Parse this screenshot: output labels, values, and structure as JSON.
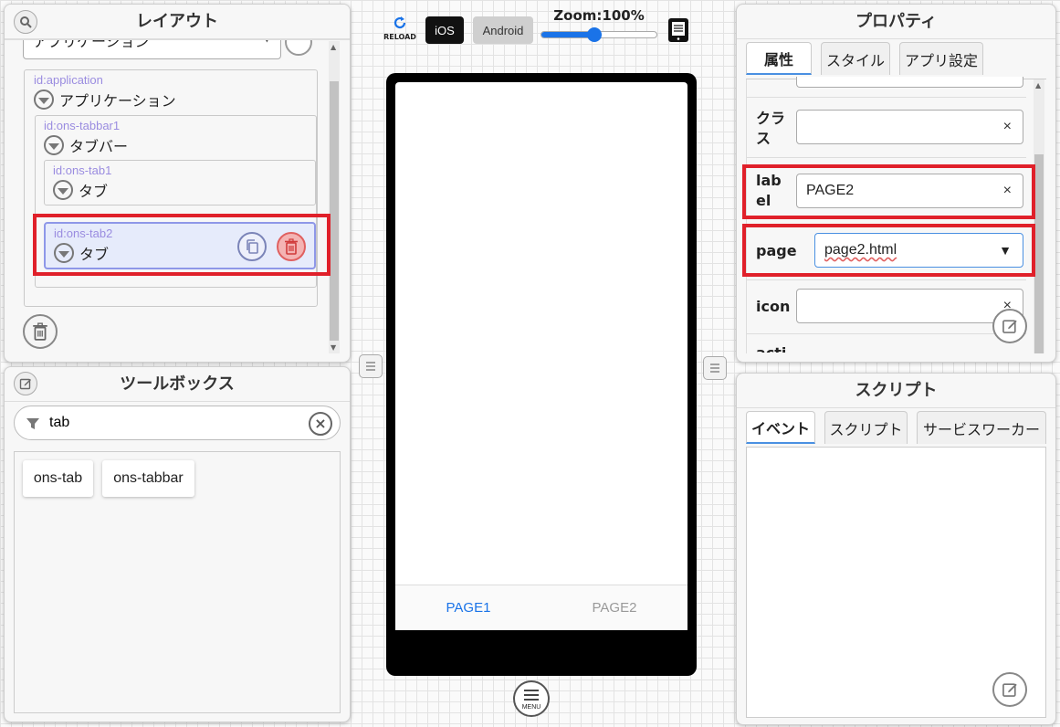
{
  "layout": {
    "title": "レイアウト",
    "top_select_value": "アプリケーション",
    "nodes": {
      "application": {
        "id": "id:application",
        "label": "アプリケーション"
      },
      "tabbar": {
        "id": "id:ons-tabbar1",
        "label": "タブバー"
      },
      "tab1": {
        "id": "id:ons-tab1",
        "label": "タブ"
      },
      "tab2": {
        "id": "id:ons-tab2",
        "label": "タブ"
      }
    }
  },
  "toolbox": {
    "title": "ツールボックス",
    "filter_value": "tab",
    "items": [
      "ons-tab",
      "ons-tabbar"
    ]
  },
  "toolbar": {
    "reload_label": "RELOAD",
    "ios_label": "iOS",
    "android_label": "Android",
    "zoom_label": "Zoom:100%",
    "zoom_value": 0.45
  },
  "phone": {
    "tabs": [
      "PAGE1",
      "PAGE2"
    ],
    "active_tab": 0
  },
  "menu_label": "MENU",
  "properties": {
    "title": "プロパティ",
    "tabs": [
      "属性",
      "スタイル",
      "アプリ設定"
    ],
    "fields": {
      "class_label": "クラ\nス",
      "label_label": "lab\nel",
      "label_value": "PAGE2",
      "page_label": "page",
      "page_value": "page2.html",
      "icon_label": "icon",
      "cut_label": "acti"
    },
    "clear_glyph": "×",
    "dropdown_glyph": "▼"
  },
  "script": {
    "title": "スクリプト",
    "tabs": [
      "イベント",
      "スクリプト",
      "サービスワーカー"
    ]
  },
  "colors": {
    "accent_blue": "#1a73e8",
    "highlight_red": "#e0202a",
    "selected_bg": "#e6ebfb",
    "selected_border": "#8e97e8"
  }
}
